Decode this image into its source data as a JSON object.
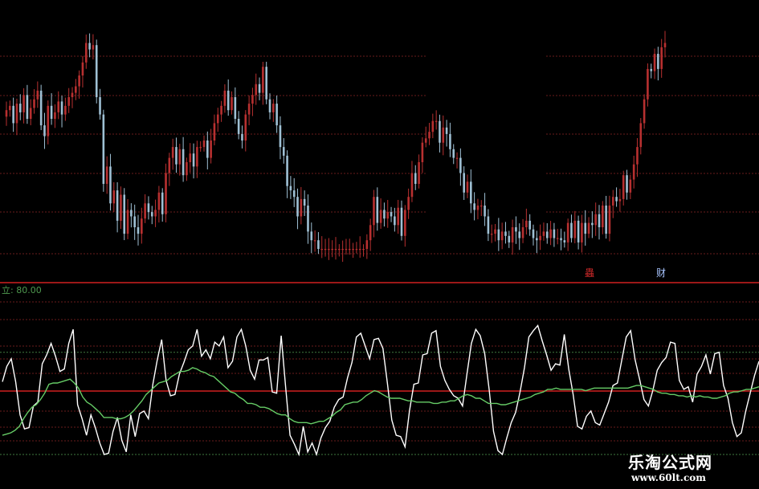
{
  "indicator_label": "立: 80.00",
  "markers": [
    "蟲",
    "财"
  ],
  "watermark": {
    "title": "乐淘公式网",
    "url": "www.60lt.com"
  },
  "colors": {
    "background": "#000000",
    "up_candle": "#b83030",
    "down_candle": "#9fc0d4",
    "grid": "#6a1d1d",
    "separator": "#d02020",
    "green_level": "#3f7a3f",
    "white_line": "#ffffff",
    "green_line": "#66cc66"
  },
  "chart_data": [
    {
      "type": "candlestick",
      "panel": "price",
      "title": "",
      "grid": true,
      "close": [
        64,
        66,
        58,
        67,
        63,
        71,
        60,
        65,
        69,
        73,
        57,
        52,
        66,
        60,
        63,
        68,
        62,
        66,
        70,
        72,
        75,
        80,
        86,
        95,
        92,
        94,
        70,
        62,
        30,
        38,
        21,
        27,
        13,
        25,
        7,
        18,
        15,
        10,
        7,
        14,
        21,
        17,
        15,
        18,
        26,
        16,
        35,
        42,
        47,
        39,
        46,
        34,
        40,
        44,
        38,
        47,
        47,
        50,
        42,
        50,
        58,
        62,
        66,
        73,
        64,
        70,
        60,
        53,
        50,
        62,
        67,
        71,
        76,
        72,
        84,
        69,
        63,
        67,
        57,
        47,
        43,
        29,
        27,
        24,
        15,
        23,
        20,
        8,
        4,
        4,
        0,
        0,
        0,
        0,
        0,
        0,
        0,
        0,
        0,
        0,
        0,
        0,
        0,
        0,
        4,
        11,
        24,
        12,
        18,
        14,
        17,
        15,
        11,
        19,
        6,
        18,
        24,
        35,
        30,
        40,
        49,
        51,
        54,
        59,
        59,
        49,
        56,
        53,
        46,
        42,
        42,
        35,
        26,
        31,
        21,
        18,
        20,
        20,
        15,
        7,
        7,
        9,
        4,
        8,
        6,
        3,
        10,
        8,
        5,
        10,
        13,
        9,
        5,
        4,
        6,
        8,
        5,
        9,
        5,
        5,
        4,
        3,
        12,
        5,
        13,
        3,
        12,
        7,
        12,
        11,
        16,
        10,
        20,
        7,
        20,
        24,
        22,
        23,
        34,
        26,
        32,
        39,
        47,
        58,
        69,
        83,
        82,
        90,
        83,
        93,
        95
      ],
      "ylim": [
        0,
        100
      ]
    },
    {
      "type": "line",
      "panel": "oscillator",
      "grid": true,
      "reference_levels": [
        80,
        50,
        0
      ],
      "series": [
        {
          "color": "white",
          "values": [
            57,
            69,
            75,
            57,
            31,
            20,
            21,
            38,
            41,
            71,
            78,
            87,
            77,
            65,
            67,
            87,
            98,
            39,
            28,
            15,
            31,
            21,
            9,
            0,
            1,
            18,
            29,
            11,
            2,
            31,
            14,
            32,
            34,
            28,
            55,
            74,
            90,
            58,
            46,
            47,
            63,
            72,
            82,
            85,
            98,
            77,
            82,
            75,
            88,
            85,
            92,
            68,
            73,
            92,
            98,
            85,
            66,
            59,
            74,
            74,
            76,
            49,
            48,
            93,
            53,
            15,
            8,
            0,
            22,
            2,
            9,
            0,
            13,
            21,
            26,
            37,
            43,
            45,
            60,
            72,
            92,
            95,
            85,
            75,
            90,
            91,
            83,
            56,
            27,
            15,
            14,
            6,
            34,
            55,
            56,
            78,
            79,
            95,
            97,
            69,
            58,
            51,
            46,
            44,
            38,
            63,
            87,
            98,
            93,
            79,
            51,
            18,
            3,
            0,
            13,
            25,
            33,
            49,
            68,
            92,
            97,
            101,
            89,
            78,
            66,
            71,
            70,
            94,
            67,
            47,
            22,
            20,
            30,
            34,
            25,
            23,
            32,
            41,
            54,
            56,
            74,
            92,
            97,
            74,
            59,
            43,
            38,
            50,
            66,
            72,
            76,
            88,
            87,
            58,
            51,
            53,
            41,
            63,
            69,
            78,
            63,
            79,
            80,
            54,
            44,
            25,
            14,
            17,
            34,
            48,
            62,
            73
          ]
        },
        {
          "color": "green",
          "values": [
            15,
            16,
            17,
            19,
            22,
            28,
            33,
            37,
            39,
            43,
            48,
            55,
            56,
            56,
            57,
            58,
            59,
            56,
            52,
            45,
            41,
            39,
            36,
            33,
            29,
            29,
            29,
            28,
            28,
            29,
            31,
            34,
            38,
            42,
            47,
            50,
            53,
            56,
            57,
            58,
            61,
            63,
            65,
            65,
            66,
            68,
            67,
            65,
            64,
            62,
            61,
            58,
            55,
            52,
            49,
            48,
            45,
            43,
            40,
            40,
            39,
            37,
            37,
            36,
            34,
            32,
            31,
            31,
            28,
            26,
            25,
            25,
            25,
            24,
            25,
            26,
            26,
            28,
            30,
            33,
            35,
            39,
            40,
            41,
            41,
            43,
            46,
            48,
            50,
            49,
            47,
            45,
            44,
            44,
            44,
            43,
            42,
            42,
            41,
            41,
            41,
            41,
            40,
            40,
            41,
            41,
            42,
            42,
            44,
            46,
            47,
            46,
            44,
            44,
            42,
            40,
            40,
            40,
            39,
            39,
            40,
            41,
            42,
            43,
            44,
            45,
            47,
            48,
            49,
            51,
            51,
            52,
            51,
            51,
            51,
            51,
            51,
            51,
            50,
            51,
            52,
            52,
            52,
            52,
            52,
            52,
            52,
            52,
            52,
            53,
            54,
            54,
            53,
            52,
            51,
            49,
            48,
            48,
            47,
            47,
            46,
            46,
            45,
            46,
            45,
            46,
            45,
            45,
            44,
            44,
            45,
            46,
            48,
            49,
            49,
            50,
            51,
            51,
            52,
            53
          ]
        }
      ],
      "ylim": [
        0,
        100
      ]
    }
  ]
}
